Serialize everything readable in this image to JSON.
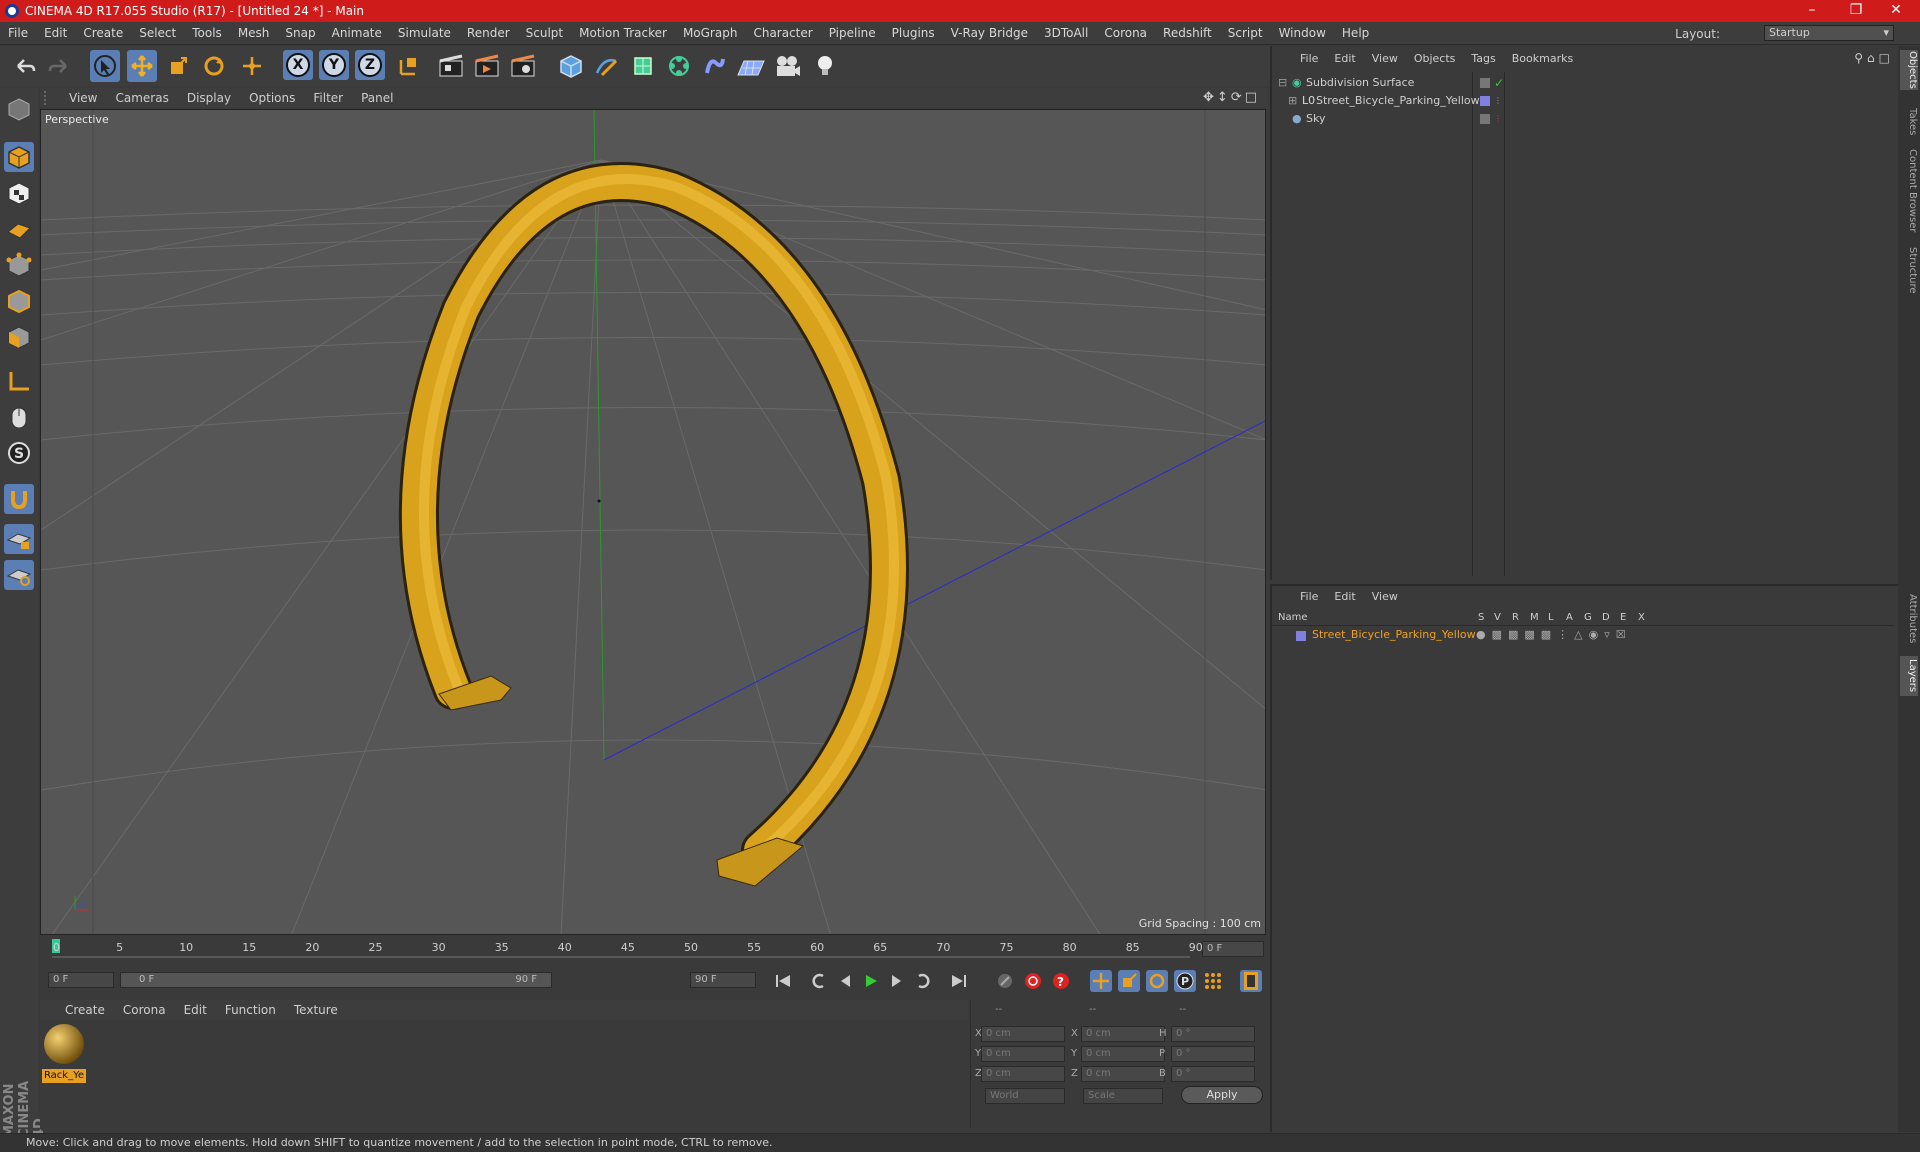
{
  "window": {
    "title": "CINEMA 4D R17.055 Studio (R17) - [Untitled 24 *] - Main"
  },
  "menubar": {
    "items": [
      "File",
      "Edit",
      "Create",
      "Select",
      "Tools",
      "Mesh",
      "Snap",
      "Animate",
      "Simulate",
      "Render",
      "Sculpt",
      "Motion Tracker",
      "MoGraph",
      "Character",
      "Pipeline",
      "Plugins",
      "V-Ray Bridge",
      "3DToAll",
      "Corona",
      "Redshift",
      "Script",
      "Window",
      "Help"
    ],
    "layout_label": "Layout:",
    "layout_value": "Startup"
  },
  "toolbar": {
    "x_label": "X",
    "y_label": "Y",
    "z_label": "Z"
  },
  "viewport": {
    "menu": [
      "View",
      "Cameras",
      "Display",
      "Options",
      "Filter",
      "Panel"
    ],
    "label": "Perspective",
    "grid_spacing": "Grid Spacing : 100 cm"
  },
  "timeline": {
    "ticks": [
      "0",
      "5",
      "10",
      "15",
      "20",
      "25",
      "30",
      "35",
      "40",
      "45",
      "50",
      "55",
      "60",
      "65",
      "70",
      "75",
      "80",
      "85",
      "90"
    ],
    "current_frame": "0 F",
    "start": "0 F",
    "slider_start": "0 F",
    "slider_end": "90 F",
    "end": "90 F"
  },
  "materials": {
    "menu": [
      "Create",
      "Corona",
      "Edit",
      "Function",
      "Texture"
    ],
    "items": [
      {
        "name": "Rack_Ye"
      }
    ]
  },
  "coords": {
    "headers": [
      "--",
      "--",
      "--"
    ],
    "rows": [
      {
        "a": "X",
        "av": "0 cm",
        "b": "X",
        "bv": "0 cm",
        "c": "H",
        "cv": "0 °"
      },
      {
        "a": "Y",
        "av": "0 cm",
        "b": "Y",
        "bv": "0 cm",
        "c": "P",
        "cv": "0 °"
      },
      {
        "a": "Z",
        "av": "0 cm",
        "b": "Z",
        "bv": "0 cm",
        "c": "B",
        "cv": "0 °"
      }
    ],
    "mode1": "World",
    "mode2": "Scale",
    "apply": "Apply"
  },
  "objects": {
    "menu": [
      "File",
      "Edit",
      "View",
      "Objects",
      "Tags",
      "Bookmarks"
    ],
    "rows": [
      {
        "name": "Subdivision Surface"
      },
      {
        "name": "Street_Bicycle_Parking_Yellow"
      },
      {
        "name": "Sky"
      }
    ]
  },
  "layers": {
    "menu": [
      "File",
      "Edit",
      "View"
    ],
    "columns": [
      "Name",
      "S",
      "V",
      "R",
      "M",
      "L",
      "A",
      "G",
      "D",
      "E",
      "X"
    ],
    "rows": [
      {
        "name": "Street_Bicycle_Parking_Yellow"
      }
    ]
  },
  "side_tabs": [
    "Objects",
    "Takes",
    "Content Browser",
    "Structure",
    "Attributes",
    "Layers"
  ],
  "status": "Move: Click and drag to move elements. Hold down SHIFT to quantize movement / add to the selection in point mode, CTRL to remove.",
  "brand": "MAXON CINEMA 4D",
  "colors": {
    "title_bar": "#d01b1b",
    "selection": "#5b7fb5",
    "object_yellow": "#e0a81e",
    "layer_text": "#f0a020"
  }
}
